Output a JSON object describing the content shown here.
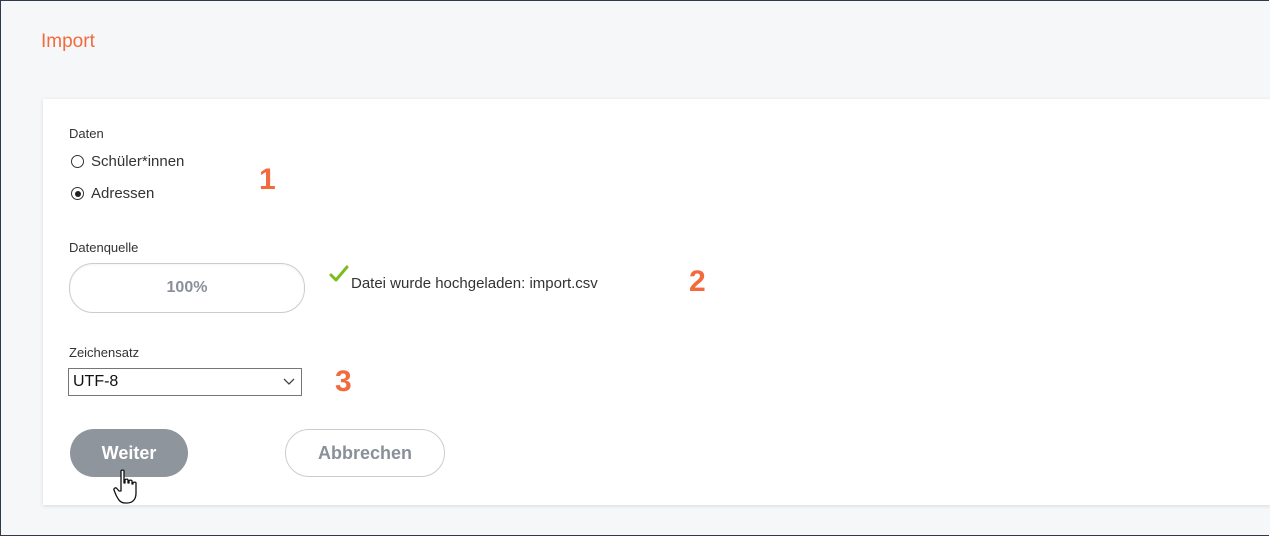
{
  "page": {
    "title": "Import"
  },
  "colors": {
    "accent": "#f26a3d",
    "button_primary": "#8e959c",
    "check": "#7dbb1e"
  },
  "data_section": {
    "label": "Daten",
    "options": [
      {
        "label": "Schüler*innen",
        "checked": false
      },
      {
        "label": "Adressen",
        "checked": true
      }
    ],
    "annotation": "1"
  },
  "source_section": {
    "label": "Datenquelle",
    "progress_text": "100%",
    "progress_value": 1.0,
    "status_icon": "checkmark-icon",
    "status_text": "Datei wurde hochgeladen: import.csv",
    "annotation": "2"
  },
  "charset_section": {
    "label": "Zeichensatz",
    "selected": "UTF-8",
    "annotation": "3"
  },
  "actions": {
    "next_label": "Weiter",
    "cancel_label": "Abbrechen"
  },
  "cursor": "hand-pointer-icon"
}
